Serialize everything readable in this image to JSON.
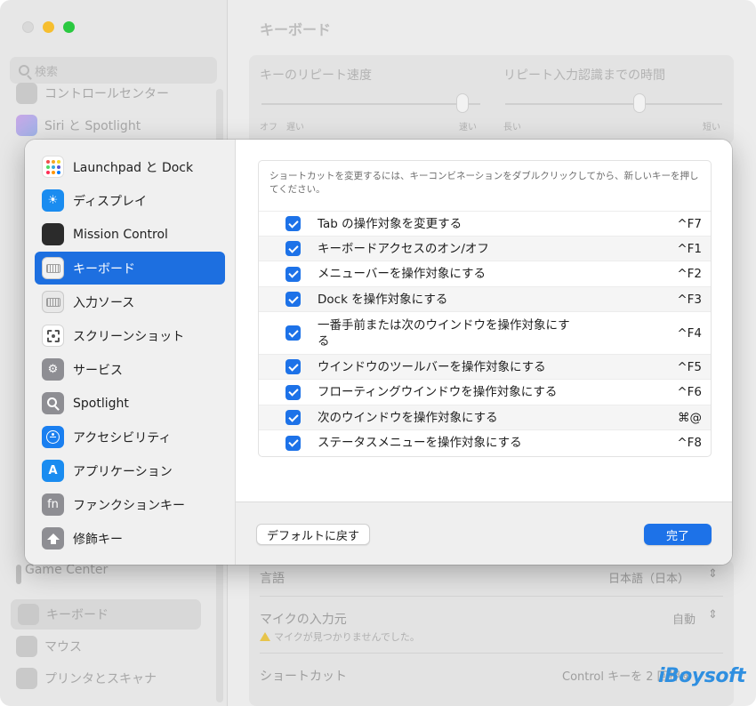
{
  "background": {
    "search_placeholder": "検索",
    "sidebar_items": [
      {
        "label": "コントロールセンター",
        "icon": "control-center-icon"
      },
      {
        "label": "Siri と Spotlight",
        "icon": "siri-icon"
      },
      {
        "label": "Game Center",
        "icon": "game-center-icon"
      },
      {
        "label": "キーボード",
        "icon": "keyboard-icon"
      },
      {
        "label": "マウス",
        "icon": "mouse-icon"
      },
      {
        "label": "プリンタとスキャナ",
        "icon": "printer-icon"
      }
    ],
    "page_title": "キーボード",
    "repeat_rate_label": "キーのリピート速度",
    "repeat_rate_left": "オフ　遅い",
    "repeat_rate_right": "速い",
    "repeat_rate_value": 0.92,
    "repeat_delay_label": "リピート入力認識までの時間",
    "repeat_delay_left": "長い",
    "repeat_delay_right": "短い",
    "repeat_delay_value": 0.62,
    "rows": [
      {
        "label": "言語",
        "value": "日本語（日本）"
      },
      {
        "label": "マイクの入力元",
        "value": "自動",
        "warning": "マイクが見つかりませんでした。"
      },
      {
        "label": "ショートカット",
        "value": "Control キーを 2 回押す"
      }
    ],
    "watermark": "iBoysoft"
  },
  "sheet": {
    "categories": [
      {
        "label": "Launchpad と Dock",
        "icon": "launchpad-icon",
        "selected": false
      },
      {
        "label": "ディスプレイ",
        "icon": "display-icon",
        "selected": false
      },
      {
        "label": "Mission Control",
        "icon": "mission-control-icon",
        "selected": false
      },
      {
        "label": "キーボード",
        "icon": "keyboard-icon",
        "selected": true
      },
      {
        "label": "入力ソース",
        "icon": "input-source-icon",
        "selected": false
      },
      {
        "label": "スクリーンショット",
        "icon": "screenshot-icon",
        "selected": false
      },
      {
        "label": "サービス",
        "icon": "services-icon",
        "selected": false
      },
      {
        "label": "Spotlight",
        "icon": "spotlight-icon",
        "selected": false
      },
      {
        "label": "アクセシビリティ",
        "icon": "accessibility-icon",
        "selected": false
      },
      {
        "label": "アプリケーション",
        "icon": "app-store-icon",
        "selected": false
      },
      {
        "label": "ファンクションキー",
        "icon": "fn-key-icon",
        "selected": false
      },
      {
        "label": "修飾キー",
        "icon": "modifier-key-icon",
        "selected": false
      }
    ],
    "hint": "ショートカットを変更するには、キーコンビネーションをダブルクリックしてから、新しいキーを押してください。",
    "shortcuts": [
      {
        "label": "Tab の操作対象を変更する",
        "key": "^F7",
        "checked": true
      },
      {
        "label": "キーボードアクセスのオン/オフ",
        "key": "^F1",
        "checked": true
      },
      {
        "label": "メニューバーを操作対象にする",
        "key": "^F2",
        "checked": true
      },
      {
        "label": "Dock を操作対象にする",
        "key": "^F3",
        "checked": true
      },
      {
        "label": "一番手前または次のウインドウを操作対象にする",
        "key": "^F4",
        "checked": true
      },
      {
        "label": "ウインドウのツールバーを操作対象にする",
        "key": "^F5",
        "checked": true
      },
      {
        "label": "フローティングウインドウを操作対象にする",
        "key": "^F6",
        "checked": true
      },
      {
        "label": "次のウインドウを操作対象にする",
        "key": "⌘@",
        "checked": true
      },
      {
        "label": "ステータスメニューを操作対象にする",
        "key": "^F8",
        "checked": true
      }
    ],
    "default_button": "デフォルトに戻す",
    "done_button": "完了"
  },
  "colors": {
    "accent": "#1d72e8",
    "selection": "#1d6fe0"
  }
}
